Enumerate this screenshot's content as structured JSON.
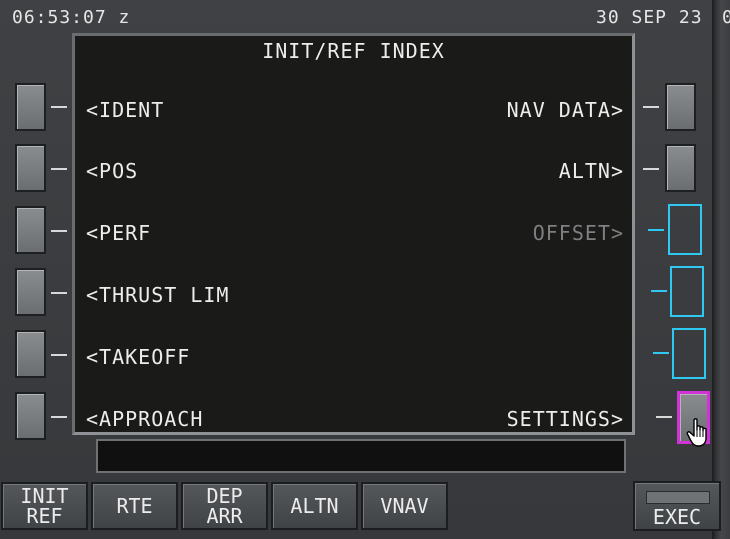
{
  "status_bar": {
    "time": "06:53:07 z",
    "date": "30 SEP 23",
    "edge_char": "0"
  },
  "page": {
    "title": "INIT/REF INDEX"
  },
  "left_lines": [
    {
      "label": "<IDENT"
    },
    {
      "label": "<POS"
    },
    {
      "label": "<PERF"
    },
    {
      "label": "<THRUST LIM"
    },
    {
      "label": "<TAKEOFF"
    },
    {
      "label": "<APPROACH"
    }
  ],
  "right_lines": [
    {
      "label": "NAV DATA>",
      "enabled": true
    },
    {
      "label": "ALTN>",
      "enabled": true
    },
    {
      "label": "OFFSET>",
      "enabled": false
    },
    {
      "label": "",
      "enabled": false
    },
    {
      "label": "",
      "enabled": false
    },
    {
      "label": "SETTINGS>",
      "enabled": true
    }
  ],
  "scratchpad": {
    "value": ""
  },
  "function_keys": [
    {
      "line1": "INIT",
      "line2": "REF"
    },
    {
      "line1": "RTE",
      "line2": ""
    },
    {
      "line1": "DEP",
      "line2": "ARR"
    },
    {
      "line1": "ALTN",
      "line2": ""
    },
    {
      "line1": "VNAV",
      "line2": ""
    }
  ],
  "exec_key": {
    "label": "EXEC"
  },
  "colors": {
    "selectable_empty": "#2fc8f0",
    "hover_highlight": "#d233d6",
    "screen_bg": "#1a1a18"
  },
  "icons": {
    "cursor": "hand-pointer-icon"
  }
}
